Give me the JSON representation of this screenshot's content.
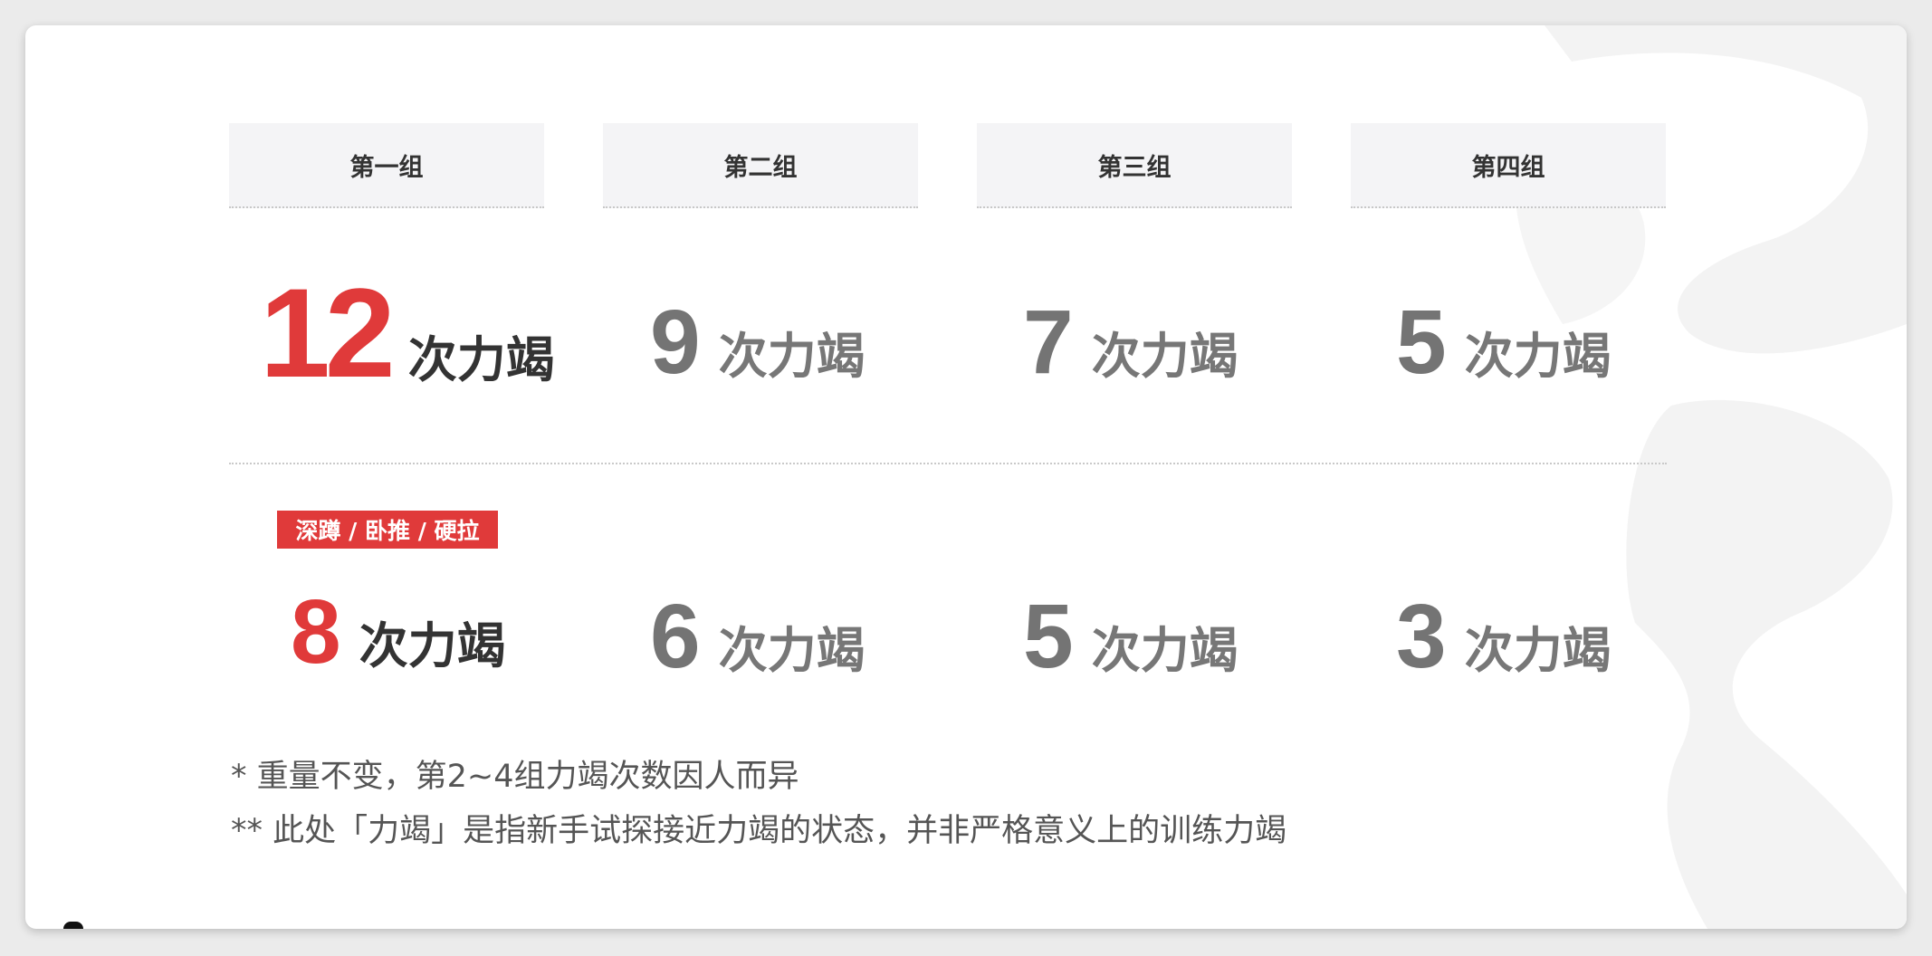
{
  "tabs": [
    "第一组",
    "第二组",
    "第三组",
    "第四组"
  ],
  "unit": "次力竭",
  "row1": [
    "12",
    "9",
    "7",
    "5"
  ],
  "badge": "深蹲 / 卧推 / 硬拉",
  "row2": [
    "8",
    "6",
    "5",
    "3"
  ],
  "notes": [
    "* 重量不变，第2~4组力竭次数因人而异",
    "** 此处「力竭」是指新手试探接近力竭的状态，并非严格意义上的训练力竭"
  ],
  "colors": {
    "accent": "#e03a3a",
    "number_gray": "#747474",
    "tab_bg": "#f4f4f6",
    "frame_bg": "#ebebeb"
  }
}
